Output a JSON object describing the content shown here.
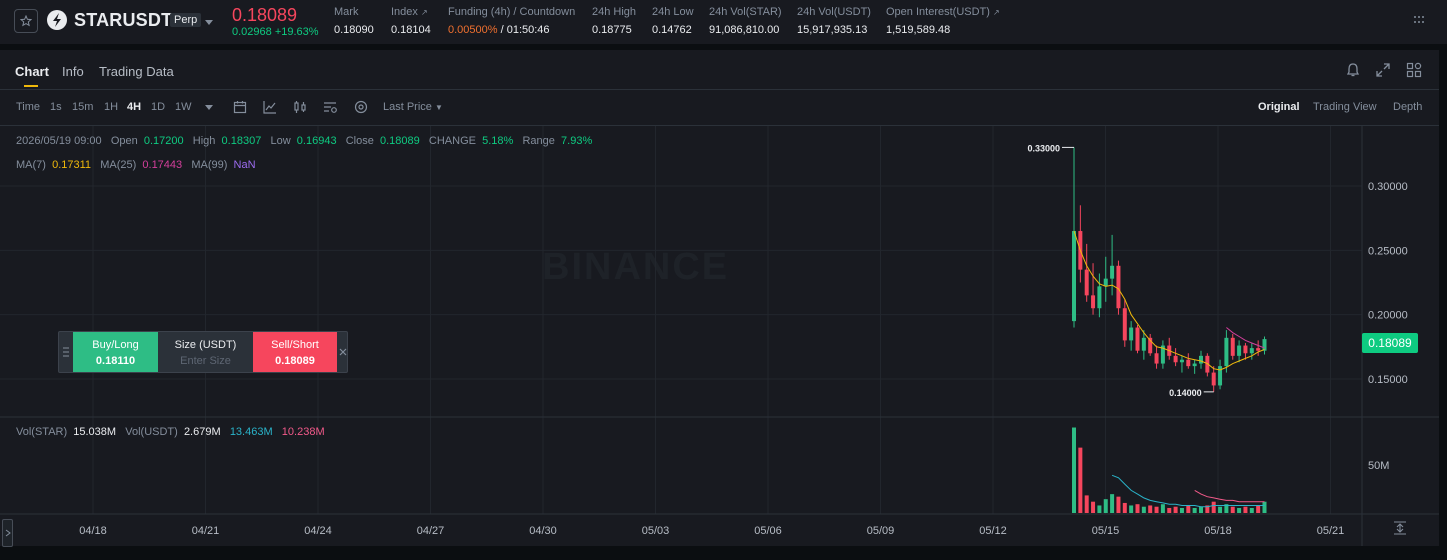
{
  "ticker": {
    "symbol": "STARUSDT",
    "badge": "Perp",
    "last_price": "0.18089",
    "change": "0.02968 +19.63%",
    "stats": [
      {
        "label": "Mark",
        "value": "0.18090"
      },
      {
        "label": "Index",
        "value": "0.18104"
      },
      {
        "label": "Funding (4h) / Countdown",
        "value_warn": "0.00500%",
        "value": " / 01:50:46"
      },
      {
        "label": "24h High",
        "value": "0.18775"
      },
      {
        "label": "24h Low",
        "value": "0.14762"
      },
      {
        "label": "24h Vol(STAR)",
        "value": "91,086,810.00"
      },
      {
        "label": "24h Vol(USDT)",
        "value": "15,917,935.13"
      },
      {
        "label": "Open Interest(USDT)",
        "value": "1,519,589.48"
      }
    ],
    "colors": {
      "down": "#f6465d",
      "up": "#0ecb81",
      "warn": "#f0702f"
    }
  },
  "tabs": [
    "Chart",
    "Info",
    "Trading Data"
  ],
  "active_tab": "Chart",
  "toolbar": {
    "time_label": "Time",
    "intervals": [
      "1s",
      "15m",
      "1H",
      "4H",
      "1D",
      "1W"
    ],
    "active_interval": "4H",
    "price_type": "Last Price",
    "views": [
      "Original",
      "Trading View",
      "Depth"
    ],
    "active_view": "Original"
  },
  "ohlc": {
    "date": "2026/05/19 09:00",
    "open_label": "Open",
    "open": "0.17200",
    "high_label": "High",
    "high": "0.18307",
    "low_label": "Low",
    "low": "0.16943",
    "close_label": "Close",
    "close": "0.18089",
    "change_label": "CHANGE",
    "change": "5.18%",
    "range_label": "Range",
    "range": "7.93%"
  },
  "ma": {
    "ma7_label": "MA(7)",
    "ma7": "0.17311",
    "ma25_label": "MA(25)",
    "ma25": "0.17443",
    "ma99_label": "MA(99)",
    "ma99": "NaN"
  },
  "volume": {
    "vol_star_label": "Vol(STAR)",
    "vol_star": "15.038M",
    "vol_usdt_label": "Vol(USDT)",
    "vol_usdt": "2.679M",
    "ma1": "13.463M",
    "ma2": "10.238M"
  },
  "watermark": "BINANCE",
  "current_price_tag": "0.18089",
  "order_widget": {
    "buy_label": "Buy/Long",
    "buy_price": "0.18110",
    "size_label": "Size (USDT)",
    "size_placeholder": "Enter Size",
    "sell_label": "Sell/Short",
    "sell_price": "0.18089"
  },
  "chart_data": {
    "type": "candlestick",
    "x_ticks": [
      "04/18",
      "04/21",
      "04/24",
      "04/27",
      "04/30",
      "05/03",
      "05/06",
      "05/09",
      "05/12",
      "05/15",
      "05/18",
      "05/21"
    ],
    "y_ticks": [
      "0.30000",
      "0.25000",
      "0.20000",
      "0.15000"
    ],
    "y_range": [
      0.13,
      0.34
    ],
    "volume_tick": "50M",
    "max_label": "0.33000",
    "min_label": "0.14000",
    "candles": [
      {
        "o": 0.195,
        "h": 0.33,
        "l": 0.19,
        "c": 0.265
      },
      {
        "o": 0.265,
        "h": 0.285,
        "l": 0.225,
        "c": 0.235
      },
      {
        "o": 0.235,
        "h": 0.255,
        "l": 0.21,
        "c": 0.215
      },
      {
        "o": 0.215,
        "h": 0.24,
        "l": 0.2,
        "c": 0.205
      },
      {
        "o": 0.205,
        "h": 0.232,
        "l": 0.198,
        "c": 0.222
      },
      {
        "o": 0.222,
        "h": 0.245,
        "l": 0.21,
        "c": 0.228
      },
      {
        "o": 0.228,
        "h": 0.262,
        "l": 0.215,
        "c": 0.238
      },
      {
        "o": 0.238,
        "h": 0.242,
        "l": 0.2,
        "c": 0.205
      },
      {
        "o": 0.205,
        "h": 0.212,
        "l": 0.175,
        "c": 0.18
      },
      {
        "o": 0.18,
        "h": 0.195,
        "l": 0.172,
        "c": 0.19
      },
      {
        "o": 0.19,
        "h": 0.192,
        "l": 0.17,
        "c": 0.172
      },
      {
        "o": 0.172,
        "h": 0.188,
        "l": 0.165,
        "c": 0.182
      },
      {
        "o": 0.182,
        "h": 0.185,
        "l": 0.168,
        "c": 0.17
      },
      {
        "o": 0.17,
        "h": 0.176,
        "l": 0.158,
        "c": 0.162
      },
      {
        "o": 0.162,
        "h": 0.18,
        "l": 0.158,
        "c": 0.176
      },
      {
        "o": 0.176,
        "h": 0.182,
        "l": 0.165,
        "c": 0.168
      },
      {
        "o": 0.168,
        "h": 0.174,
        "l": 0.16,
        "c": 0.163
      },
      {
        "o": 0.163,
        "h": 0.168,
        "l": 0.155,
        "c": 0.165
      },
      {
        "o": 0.165,
        "h": 0.17,
        "l": 0.158,
        "c": 0.16
      },
      {
        "o": 0.16,
        "h": 0.165,
        "l": 0.154,
        "c": 0.162
      },
      {
        "o": 0.162,
        "h": 0.172,
        "l": 0.158,
        "c": 0.168
      },
      {
        "o": 0.168,
        "h": 0.17,
        "l": 0.152,
        "c": 0.155
      },
      {
        "o": 0.155,
        "h": 0.16,
        "l": 0.14,
        "c": 0.145
      },
      {
        "o": 0.145,
        "h": 0.165,
        "l": 0.142,
        "c": 0.16
      },
      {
        "o": 0.16,
        "h": 0.188,
        "l": 0.155,
        "c": 0.182
      },
      {
        "o": 0.182,
        "h": 0.185,
        "l": 0.165,
        "c": 0.168
      },
      {
        "o": 0.168,
        "h": 0.18,
        "l": 0.163,
        "c": 0.176
      },
      {
        "o": 0.176,
        "h": 0.178,
        "l": 0.165,
        "c": 0.17
      },
      {
        "o": 0.17,
        "h": 0.178,
        "l": 0.165,
        "c": 0.174
      },
      {
        "o": 0.174,
        "h": 0.18,
        "l": 0.168,
        "c": 0.172
      },
      {
        "o": 0.172,
        "h": 0.183,
        "l": 0.169,
        "c": 0.181
      }
    ],
    "volumes_m": [
      68,
      52,
      14,
      9,
      6,
      11,
      15,
      13,
      8,
      6,
      7,
      5,
      6,
      5,
      7,
      4,
      5,
      4,
      6,
      4,
      5,
      6,
      9,
      5,
      7,
      5,
      4,
      5,
      4,
      6,
      9
    ],
    "ma7": [
      0.265,
      0.25,
      0.238,
      0.23,
      0.224,
      0.222,
      0.223,
      0.22,
      0.212,
      0.2,
      0.193,
      0.186,
      0.18,
      0.175,
      0.174,
      0.172,
      0.17,
      0.168,
      0.166,
      0.165,
      0.164,
      0.162,
      0.158,
      0.157,
      0.159,
      0.162,
      0.164,
      0.166,
      0.168,
      0.171,
      0.173
    ],
    "ma25": [
      null,
      null,
      null,
      null,
      null,
      null,
      null,
      null,
      null,
      null,
      null,
      null,
      null,
      null,
      null,
      null,
      null,
      null,
      null,
      null,
      null,
      null,
      null,
      null,
      0.19,
      0.186,
      0.183,
      0.18,
      0.178,
      0.176,
      0.174
    ],
    "vol_ma_cyan_m": [
      null,
      null,
      null,
      null,
      null,
      null,
      30,
      28,
      23,
      18,
      15,
      12,
      10,
      9,
      8,
      7,
      7,
      6,
      6,
      6,
      5,
      5,
      6,
      6,
      6,
      6,
      6,
      6,
      6,
      6,
      6
    ],
    "vol_ma_pink_m": [
      null,
      null,
      null,
      null,
      null,
      null,
      null,
      null,
      null,
      null,
      null,
      null,
      null,
      null,
      null,
      null,
      null,
      null,
      null,
      18,
      15,
      13,
      12,
      11,
      10,
      10,
      9,
      9,
      9,
      9,
      9
    ],
    "colors": {
      "up": "#2ebd85",
      "down": "#f6465d",
      "ma7": "#f0b90b",
      "ma25": "#d43f9b",
      "vol_ma1": "#2ab3c9",
      "vol_ma2": "#f25a8a",
      "grid": "#22262d"
    }
  }
}
